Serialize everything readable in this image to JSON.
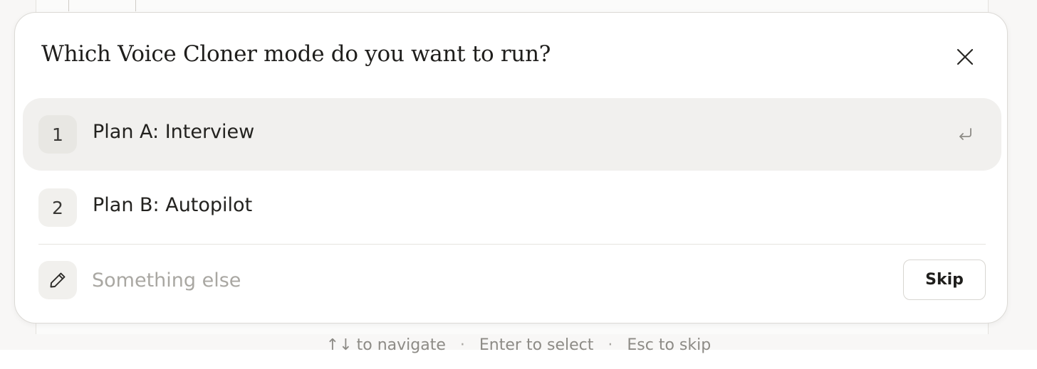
{
  "dialog": {
    "title": "Which Voice Cloner mode do you want to run?",
    "close_icon": "close-icon"
  },
  "options": [
    {
      "number": "1",
      "label": "Plan A: Interview",
      "selected": true
    },
    {
      "number": "2",
      "label": "Plan B: Autopilot",
      "selected": false
    }
  ],
  "other": {
    "placeholder": "Something else",
    "value": "",
    "icon": "pencil-icon"
  },
  "skip_label": "Skip",
  "hints": {
    "navigate_arrows": "↑↓",
    "navigate": "to navigate",
    "separator": "·",
    "select": "Enter to select",
    "skip": "Esc to skip"
  },
  "colors": {
    "selected_row": "#f1f0ee",
    "text": "#1f1e1c",
    "muted": "#8d8b86"
  }
}
